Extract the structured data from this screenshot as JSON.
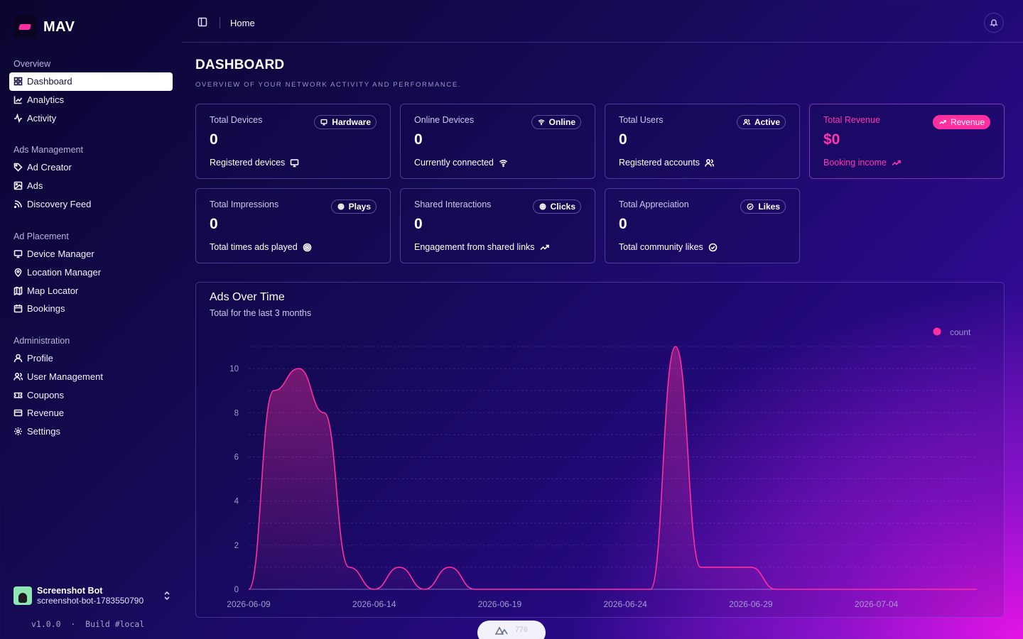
{
  "brand": {
    "name": "MAV"
  },
  "sidebar": {
    "groups": [
      {
        "label": "Overview",
        "items": [
          {
            "label": "Dashboard",
            "icon": "layout-grid-icon",
            "active": true
          },
          {
            "label": "Analytics",
            "icon": "line-chart-icon"
          },
          {
            "label": "Activity",
            "icon": "activity-icon"
          }
        ]
      },
      {
        "label": "Ads Management",
        "items": [
          {
            "label": "Ad Creator",
            "icon": "tag-icon"
          },
          {
            "label": "Ads",
            "icon": "image-icon"
          },
          {
            "label": "Discovery Feed",
            "icon": "rss-icon"
          }
        ]
      },
      {
        "label": "Ad Placement",
        "items": [
          {
            "label": "Device Manager",
            "icon": "monitor-icon"
          },
          {
            "label": "Location Manager",
            "icon": "map-pin-icon"
          },
          {
            "label": "Map Locator",
            "icon": "map-icon"
          },
          {
            "label": "Bookings",
            "icon": "calendar-icon"
          }
        ]
      },
      {
        "label": "Administration",
        "items": [
          {
            "label": "Profile",
            "icon": "user-icon"
          },
          {
            "label": "User Management",
            "icon": "users-icon"
          },
          {
            "label": "Coupons",
            "icon": "ticket-icon"
          },
          {
            "label": "Revenue",
            "icon": "credit-card-icon"
          },
          {
            "label": "Settings",
            "icon": "gear-icon"
          }
        ]
      }
    ],
    "user": {
      "name": "Screenshot Bot",
      "email": "screenshot-bot-1783550790"
    },
    "version": "v1.0.0  ·  Build #local"
  },
  "topbar": {
    "breadcrumb": "Home"
  },
  "page": {
    "title": "DASHBOARD",
    "subtitle": "OVERVIEW OF YOUR NETWORK ACTIVITY AND PERFORMANCE."
  },
  "stats": [
    {
      "label": "Total Devices",
      "value": "0",
      "badge": "Hardware",
      "badge_icon": "monitor-icon",
      "note": "Registered devices",
      "note_icon": "monitor-icon"
    },
    {
      "label": "Online Devices",
      "value": "0",
      "badge": "Online",
      "badge_icon": "wifi-icon",
      "note": "Currently connected",
      "note_icon": "wifi-icon"
    },
    {
      "label": "Total Users",
      "value": "0",
      "badge": "Active",
      "badge_icon": "users-icon",
      "note": "Registered accounts",
      "note_icon": "users-icon"
    },
    {
      "label": "Total Revenue",
      "value": "$0",
      "badge": "Revenue",
      "badge_icon": "trending-up-icon",
      "note": "Booking income",
      "note_icon": "trending-up-icon",
      "accent": "#ff37ac"
    },
    {
      "label": "Total Impressions",
      "value": "0",
      "badge": "Plays",
      "badge_icon": "target-icon",
      "note": "Total times ads played",
      "note_icon": "target-icon"
    },
    {
      "label": "Shared Interactions",
      "value": "0",
      "badge": "Clicks",
      "badge_icon": "target-icon",
      "note": "Engagement from shared links",
      "note_icon": "trending-up-icon"
    },
    {
      "label": "Total Appreciation",
      "value": "0",
      "badge": "Likes",
      "badge_icon": "check-circle-icon",
      "note": "Total community likes",
      "note_icon": "check-circle-icon"
    }
  ],
  "chart_data": {
    "type": "area",
    "title": "Ads Over Time",
    "subtitle": "Total for the last 3 months",
    "legend": "count",
    "legend_position": "top-right",
    "series": [
      {
        "name": "count",
        "color": "#ff2fa0"
      }
    ],
    "x": [
      "2026-06-09",
      "2026-06-10",
      "2026-06-11",
      "2026-06-12",
      "2026-06-13",
      "2026-06-14",
      "2026-06-15",
      "2026-06-16",
      "2026-06-17",
      "2026-06-18",
      "2026-06-19",
      "2026-06-20",
      "2026-06-21",
      "2026-06-22",
      "2026-06-23",
      "2026-06-24",
      "2026-06-25",
      "2026-06-26",
      "2026-06-27",
      "2026-06-28",
      "2026-06-29",
      "2026-06-30",
      "2026-07-01",
      "2026-07-02",
      "2026-07-03",
      "2026-07-04",
      "2026-07-05",
      "2026-07-06",
      "2026-07-07",
      "2026-07-08"
    ],
    "values": [
      0,
      9,
      10,
      8,
      1,
      0,
      1,
      0,
      1,
      0,
      0,
      0,
      0,
      0,
      0,
      0,
      0,
      11,
      1,
      1,
      1,
      0,
      0,
      0,
      0,
      0,
      0,
      0,
      0,
      0
    ],
    "x_ticks": [
      "2026-06-09",
      "2026-06-14",
      "2026-06-19",
      "2026-06-24",
      "2026-06-29",
      "2026-07-04"
    ],
    "y_ticks": [
      0,
      2,
      4,
      6,
      8,
      10
    ],
    "ylim": [
      0,
      11
    ],
    "grid": true
  },
  "devtools": {
    "label": "776"
  }
}
